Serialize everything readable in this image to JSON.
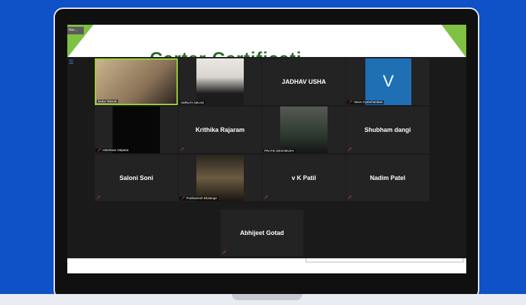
{
  "slide": {
    "title": "Certer Certificati",
    "recording": "Rec..."
  },
  "colors": {
    "background": "#0f51c6",
    "slide_green": "#7fc142",
    "active_speaker": "#9ad13a",
    "avatar_blue": "#1f6fb5",
    "muted_icon": "#ff4b4b"
  },
  "participants": [
    {
      "name": "kedar Wasule",
      "video": true,
      "active": true
    },
    {
      "name": "AMRUTA NIKAM",
      "video": true
    },
    {
      "name": "JADHAV USHA",
      "video": false
    },
    {
      "name": "Varun Gyanchandani",
      "video": false,
      "avatar": "V",
      "muted": true
    },
    {
      "name": "Hiteshwar Dalpatia",
      "video": true,
      "muted": true
    },
    {
      "name": "Krithika Rajaram",
      "video": false,
      "muted": true
    },
    {
      "name": "PRATIK DESHMUKH",
      "video": true
    },
    {
      "name": "Shubham dangi",
      "video": false,
      "muted": true
    },
    {
      "name": "Saloni Soni",
      "video": false,
      "muted": true
    },
    {
      "name": "Prathamesh Bhalange",
      "video": true,
      "muted": true
    },
    {
      "name": "v K Patil",
      "video": false,
      "muted": true
    },
    {
      "name": "Nadim Patel",
      "video": false,
      "muted": true
    },
    {
      "name": "Abhijeet Gotad",
      "video": false,
      "muted": true
    }
  ]
}
